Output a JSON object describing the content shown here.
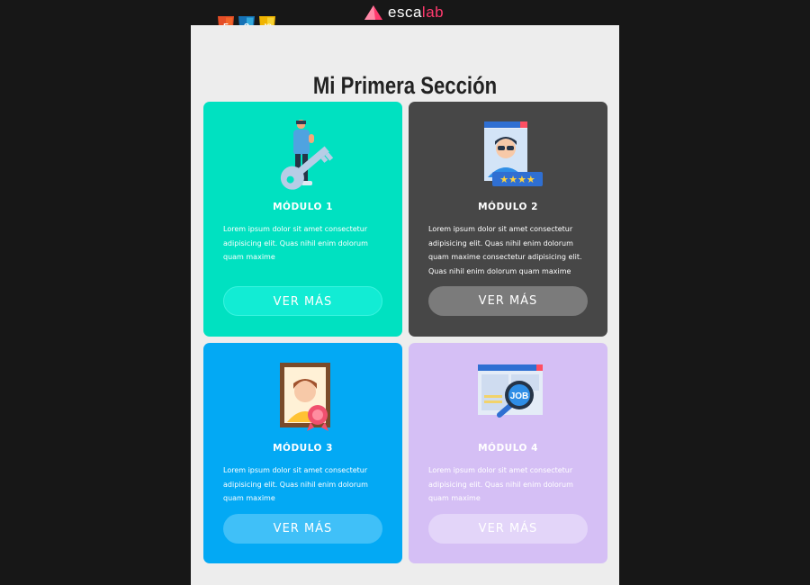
{
  "brand": {
    "name_prefix": "esca",
    "name_highlight": "lab",
    "accent_color": "#ff3a6e"
  },
  "tech_badges": [
    {
      "label": "5",
      "color": "#e44d26"
    },
    {
      "label": "3",
      "color": "#1572b6"
    },
    {
      "label": "JS",
      "color": "#f0db4f"
    }
  ],
  "section": {
    "title": "Mi Primera Sección"
  },
  "modules": [
    {
      "title": "MÓDULO 1",
      "text": "Lorem ipsum dolor sit amet consectetur adipisicing elit. Quas nihil enim dolorum quam maxime",
      "button": "VER MÁS",
      "icon": "key-person-icon",
      "bg": "#00e1c1",
      "btn_bg": "#12ecd4"
    },
    {
      "title": "MÓDULO 2",
      "text": "Lorem ipsum dolor sit amet consectetur adipisicing elit. Quas nihil enim dolorum quam maxime consectetur adipisicing elit. Quas nihil enim dolorum quam maxime",
      "button": "VER MÁS",
      "icon": "rated-profile-icon",
      "bg": "#474747",
      "btn_bg": "#7b7b7b"
    },
    {
      "title": "MÓDULO 3",
      "text": "Lorem ipsum dolor sit amet consectetur adipisicing elit. Quas nihil enim dolorum quam maxime",
      "button": "VER MÁS",
      "icon": "award-portrait-icon",
      "bg": "#03a9f4",
      "btn_bg": "#40c0f8"
    },
    {
      "title": "MÓDULO 4",
      "text": "Lorem ipsum dolor sit amet consectetur adipisicing elit. Quas nihil enim dolorum quam maxime",
      "button": "VER MÁS",
      "icon": "job-search-icon",
      "bg": "#d5bff5",
      "btn_bg": "#e3d5f9"
    }
  ]
}
